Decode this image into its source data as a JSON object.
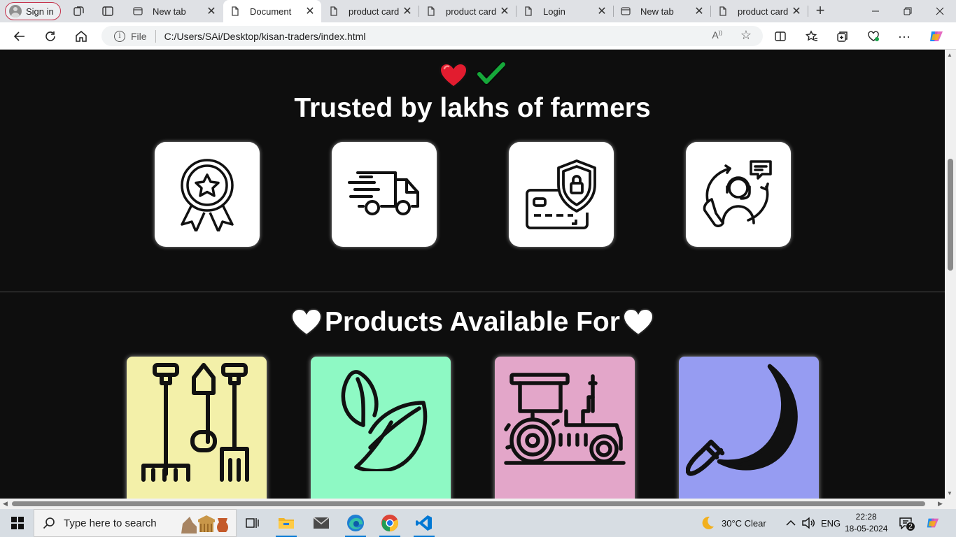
{
  "browser": {
    "sign_in_label": "Sign in",
    "tabs": [
      {
        "label": "New tab",
        "favicon": "newtab-icon",
        "active": false
      },
      {
        "label": "Document",
        "favicon": "document-icon",
        "active": true
      },
      {
        "label": "product card",
        "favicon": "document-icon",
        "active": false
      },
      {
        "label": "product card",
        "favicon": "document-icon",
        "active": false
      },
      {
        "label": "Login",
        "favicon": "document-icon",
        "active": false
      },
      {
        "label": "New tab",
        "favicon": "newtab-icon",
        "active": false
      },
      {
        "label": "product card",
        "favicon": "document-icon",
        "active": false
      }
    ],
    "address": {
      "scheme_label": "File",
      "url": "C:/Users/SAi/Desktop/kisan-traders/index.html"
    }
  },
  "page": {
    "top_emojis": [
      "heart-emoji",
      "check-mark-emoji"
    ],
    "trusted_heading": "Trusted by lakhs of farmers",
    "features": [
      {
        "icon": "quality-badge-icon"
      },
      {
        "icon": "fast-delivery-truck-icon"
      },
      {
        "icon": "secure-payment-icon"
      },
      {
        "icon": "customer-support-icon"
      }
    ],
    "products_heading": "Products Available For",
    "products": [
      {
        "icon": "gardening-tools-icon",
        "bg_color": "#f3f0a9"
      },
      {
        "icon": "leaf-icon",
        "bg_color": "#8ef9c4"
      },
      {
        "icon": "tractor-icon",
        "bg_color": "#e3a6c9"
      },
      {
        "icon": "sickle-icon",
        "bg_color": "#969cf2"
      }
    ]
  },
  "taskbar": {
    "search_placeholder": "Type here to search",
    "weather": "30°C  Clear",
    "language": "ENG",
    "time": "22:28",
    "date": "18-05-2024",
    "notification_count": "2"
  }
}
